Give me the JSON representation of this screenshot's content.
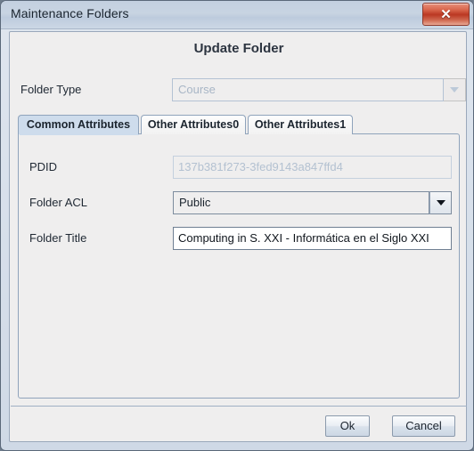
{
  "window": {
    "title": "Maintenance Folders",
    "close_icon": "close-icon",
    "close_label": "✕"
  },
  "heading": "Update Folder",
  "folder_type": {
    "label": "Folder Type",
    "value": "Course",
    "enabled": false,
    "arrow_icon": "chevron-down-icon"
  },
  "tabs": [
    {
      "label": "Common Attributes",
      "selected": true
    },
    {
      "label": "Other Attributes0",
      "selected": false
    },
    {
      "label": "Other Attributes1",
      "selected": false
    }
  ],
  "fields": {
    "pdid": {
      "label": "PDID",
      "value": "137b381f273-3fed9143a847ffd4",
      "readonly": true
    },
    "folder_acl": {
      "label": "Folder ACL",
      "value": "Public",
      "enabled": true,
      "arrow_icon": "chevron-down-icon"
    },
    "folder_title": {
      "label": "Folder Title",
      "value": "Computing in S. XXI - Informática en el Siglo XXI",
      "readonly": false
    }
  },
  "buttons": {
    "ok": "Ok",
    "cancel": "Cancel"
  },
  "colors": {
    "titlebar": "#c8d4e2",
    "close_red": "#bb3822",
    "tab_selected": "#cedcec",
    "panel_bg": "#efeeee",
    "border_blue": "#8fa3bb"
  }
}
